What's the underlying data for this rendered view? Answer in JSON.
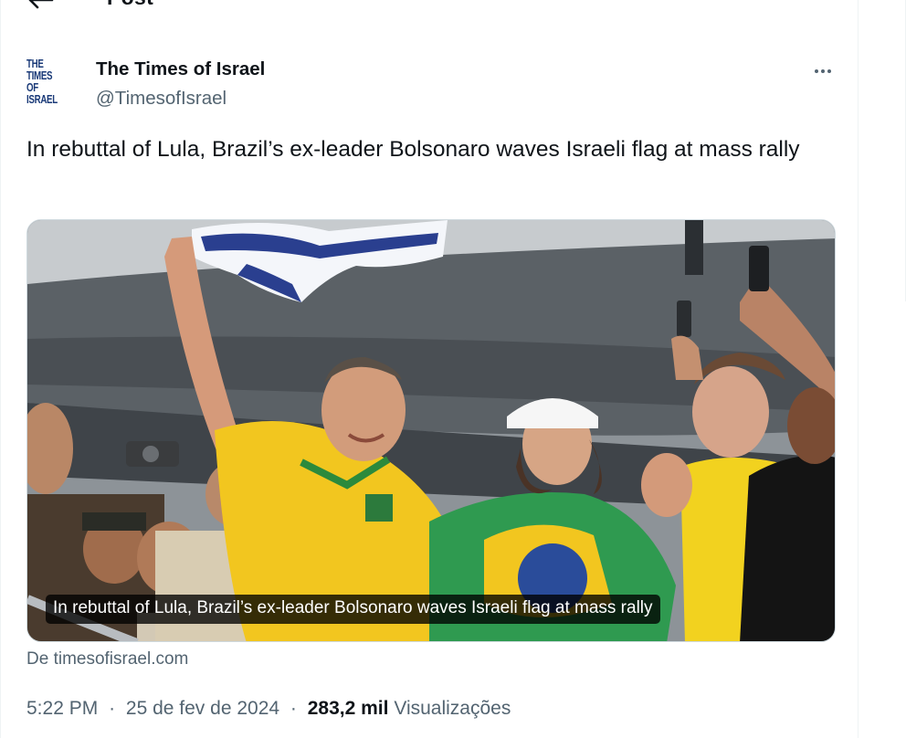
{
  "topbar": {
    "title": "Post"
  },
  "author": {
    "name": "The Times of Israel",
    "handle": "@TimesofIsrael",
    "avatar_line1": "THE TIMES",
    "avatar_line2": "OF ISRAEL"
  },
  "post": {
    "text": "In rebuttal of Lula, Brazil’s ex-leader Bolsonaro waves Israeli flag at mass rally",
    "card_caption": "In rebuttal of Lula, Brazil’s ex-leader Bolsonaro waves Israeli flag at mass rally",
    "source": "De timesofisrael.com"
  },
  "meta": {
    "time": "5:22 PM",
    "date": "25 de fev de 2024",
    "views_count": "283,2 mil",
    "views_label": "Visualizações",
    "dot": "·"
  },
  "icons": {
    "back": "arrow-left-icon",
    "more": "more-horizontal-icon"
  },
  "colors": {
    "text_primary": "#0f1419",
    "text_secondary": "#536471",
    "brand_avatar": "#1a3a78"
  }
}
